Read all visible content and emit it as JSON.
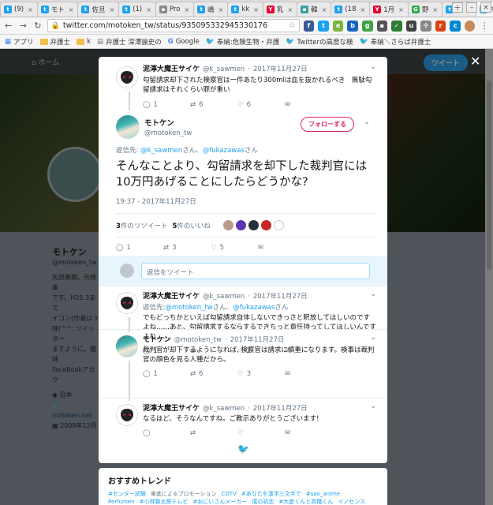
{
  "browser": {
    "tabs": [
      {
        "label": "(9)",
        "icon": "twitter-icon",
        "color": "#1da1f2"
      },
      {
        "label": "モト",
        "icon": "twitter-icon",
        "color": "#1da1f2"
      },
      {
        "label": "佐旦",
        "icon": "twitter-icon",
        "color": "#1da1f2"
      },
      {
        "label": "(1)",
        "icon": "twitter-icon",
        "color": "#1da1f2"
      },
      {
        "label": "Pro",
        "icon": "doc-icon",
        "color": "#8a8a8a"
      },
      {
        "label": "嶋",
        "icon": "twitter-icon",
        "color": "#1da1f2"
      },
      {
        "label": "kk",
        "icon": "twitter-icon",
        "color": "#1da1f2"
      },
      {
        "label": "乳",
        "icon": "yahoo-icon",
        "color": "#e60033"
      },
      {
        "label": "韓",
        "icon": "news-icon",
        "color": "#3aa0a0"
      },
      {
        "label": "(18",
        "icon": "twitter-icon",
        "color": "#1da1f2"
      },
      {
        "label": "1月",
        "icon": "yahoo-icon",
        "color": "#e60033"
      },
      {
        "label": "野",
        "icon": "google-icon",
        "color": "#34a853"
      },
      {
        "label": "泥",
        "icon": "twitter-icon",
        "color": "#1da1f2"
      },
      {
        "label": "モ",
        "icon": "twitter-icon",
        "color": "#1da1f2",
        "active": true
      }
    ],
    "url": "twitter.com/motoken_tw/status/935095332945330176",
    "bookmarks": [
      {
        "label": "アプリ",
        "type": "apps"
      },
      {
        "label": "弁護士",
        "type": "folder"
      },
      {
        "label": "k",
        "type": "folder"
      },
      {
        "label": "弁護士 深澤諭史の",
        "type": "doc"
      },
      {
        "label": "Google",
        "type": "google"
      },
      {
        "label": "奉納:危険生物・弁護",
        "type": "bird"
      },
      {
        "label": "Twitterの高度な検",
        "type": "bird"
      },
      {
        "label": "奉納＼さらば弁護士",
        "type": "bird"
      }
    ]
  },
  "background": {
    "nav_home": "ホーム",
    "tweet_button": "ツイート",
    "profile_name": "モトケン",
    "profile_handle": "@motoken_tw",
    "bio_lines": [
      "矢部善朗。元検事",
      "です。H25.3まで",
      "イコン(作者は Y",
      "味(^^; ツイッター",
      "ますように。趣味",
      "FaceBookアカウ"
    ],
    "location": "日本",
    "website": "motoken.net",
    "joined": "2008年12月"
  },
  "thread": {
    "parent": {
      "name": "泥濘大魔王サイケ",
      "handle": "@k_sawmen",
      "date": "2017年11月27日",
      "text": "勾留請求却下された検察官は一件あたり300mlは血を抜かれるべき　無駄勾留請求はそれくらい罪が重い",
      "replies": "1",
      "retweets": "6",
      "likes": "6"
    },
    "main": {
      "name": "モトケン",
      "handle": "@motoken_tw",
      "follow_label": "フォローする",
      "reply_prefix": "返信先:",
      "reply_to_1": "@k_sawmen",
      "reply_san_1": "さん、",
      "reply_to_2": "@fukazawas",
      "reply_san_2": "さん",
      "text": "そんなことより、勾留請求を却下した裁判官には10万円あげることにしたらどうかな?",
      "timestamp": "19:37 - 2017年11月27日",
      "retweet_count": "3",
      "retweet_label": "件のリツイート",
      "like_count": "5",
      "like_label": "件のいいね",
      "replies": "1",
      "retweets": "3",
      "likes": "5"
    },
    "reply_placeholder": "返信をツイート",
    "replies": [
      {
        "name": "泥濘大魔王サイケ",
        "handle": "@k_sawmen",
        "date": "2017年11月27日",
        "reply_prefix": "返信先:",
        "reply_to_1": "@motoken_tw",
        "reply_san_1": "さん、",
        "reply_to_2": "@fukazawas",
        "reply_san_2": "さん",
        "text": "でもどっちかといえば勾留請求自体しないできっさと釈放してほしいのですよね……あと、勾留請求するならするできちっと責任持ってしてほしいんですよね……",
        "replies": "1",
        "retweets": "",
        "likes": "2"
      },
      {
        "name": "モトケン",
        "handle": "@motoken_tw",
        "date": "2017年11月27日",
        "text": "裁判官が却下するようになれば, 検察官は請求に慎重になります。検事は裁判官の顔色を見る人種だから。",
        "replies": "1",
        "retweets": "6",
        "likes": "3"
      },
      {
        "name": "泥濘大魔王サイケ",
        "handle": "@k_sawmen",
        "date": "2017年11月27日",
        "text": "なるほど、そうなんですね。ご教示ありがとうございます!",
        "replies": "",
        "retweets": "",
        "likes": ""
      }
    ]
  },
  "trends": {
    "title": "おすすめトレンド",
    "line1": [
      "#センター試験",
      "東進によるプロモーション",
      "CDTV",
      "#あなたを漢字三文字で",
      "#sao_anime"
    ],
    "line2": [
      "Perfumen",
      "#小林賢太郎テレビ",
      "#おにいさんメーカー",
      "僕の初恋",
      "#大倉くんと高橋くん",
      "イノセンス"
    ]
  },
  "colors": {
    "twitter_blue": "#1da1f2",
    "like_red": "#e0245e",
    "secondary_text": "#657786"
  }
}
